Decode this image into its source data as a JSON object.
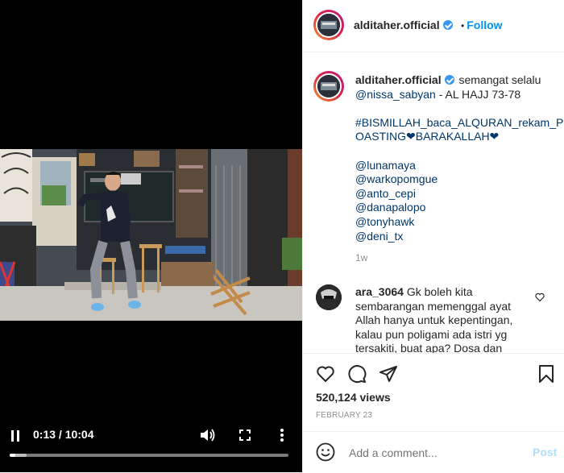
{
  "video": {
    "time": "0:13 / 10:04",
    "progress": 0.021,
    "buffered": 0.06
  },
  "header": {
    "username": "alditaher.official",
    "separator": "•",
    "follow_label": "Follow"
  },
  "caption": {
    "username": "alditaher.official",
    "text_line1": "semangat selalu",
    "mention_main": "@nissa_sabyan",
    "text_after_mention": " - AL HAJJ 73-78",
    "hashtag_line1": "#BISMILLAH_baca_ALQURAN_rekam_P",
    "hashtag_line2": "OASTING❤BARAKALLAH❤",
    "mentions": [
      "@lunamaya",
      "@warkopomgue",
      "@anto_cepi",
      "@danapalopo",
      "@tonyhawk",
      "@deni_tx"
    ],
    "age": "1w"
  },
  "comment": {
    "username": "ara_3064",
    "text": "Gk boleh kita sembarangan memenggal ayat Allah hanya untuk kepentingan, kalau pun poligami ada istri yg tersakiti, buat apa? Dosa dan"
  },
  "stats": {
    "views": "520,124 views",
    "date": "FEBRUARY 23"
  },
  "add_comment": {
    "placeholder": "Add a comment...",
    "post_label": "Post"
  }
}
